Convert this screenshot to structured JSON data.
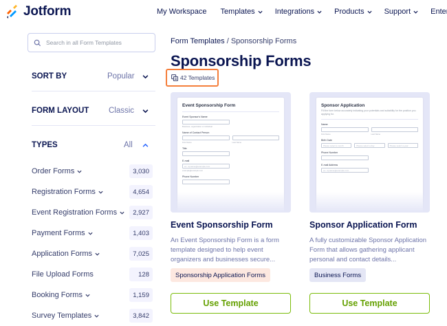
{
  "brand": {
    "name": "Jotform"
  },
  "nav": {
    "items": [
      {
        "label": "My Workspace",
        "dropdown": false
      },
      {
        "label": "Templates",
        "dropdown": true
      },
      {
        "label": "Integrations",
        "dropdown": true
      },
      {
        "label": "Products",
        "dropdown": true
      },
      {
        "label": "Support",
        "dropdown": true
      },
      {
        "label": "Enterprise",
        "dropdown": false
      }
    ]
  },
  "sidebar": {
    "search_placeholder": "Search in all Form Templates",
    "sort": {
      "title": "SORT BY",
      "value": "Popular"
    },
    "layout": {
      "title": "FORM LAYOUT",
      "value": "Classic"
    },
    "types": {
      "title": "TYPES",
      "value": "All"
    },
    "categories": [
      {
        "label": "Order Forms",
        "count": "3,030",
        "dropdown": true
      },
      {
        "label": "Registration Forms",
        "count": "4,654",
        "dropdown": true
      },
      {
        "label": "Event Registration Forms",
        "count": "2,927",
        "dropdown": true
      },
      {
        "label": "Payment Forms",
        "count": "1,403",
        "dropdown": true
      },
      {
        "label": "Application Forms",
        "count": "7,025",
        "dropdown": true
      },
      {
        "label": "File Upload Forms",
        "count": "128",
        "dropdown": false
      },
      {
        "label": "Booking Forms",
        "count": "1,159",
        "dropdown": true
      },
      {
        "label": "Survey Templates",
        "count": "3,842",
        "dropdown": true
      }
    ]
  },
  "main": {
    "breadcrumb": {
      "parent": "Form Templates",
      "separator": " / ",
      "current": "Sponsorship Forms"
    },
    "title": "Sponsorship Forms",
    "template_count": "42 Templates",
    "cards": [
      {
        "title": "Event Sponsorship Form",
        "description": "An Event Sponsorship Form is a form template designed to help event organizers and businesses secure...",
        "tag": "Sponsorship Application Forms",
        "tag_bg": "#fde8e0",
        "tag_color": "#0a1551",
        "button": "Use Template",
        "preview": {
          "title": "Event Sponsorship Form",
          "fields": {
            "sponsor_name": "Event Sponsor's Name",
            "sponsor_sub": "Business, organization or individual",
            "contact_name": "Name of Contact Person",
            "first": "First Name",
            "last": "Last Name",
            "title_label": "Title",
            "email": "E-mail",
            "email_ph": "ex: myname@example.com",
            "email_sub": "example@example.com",
            "phone": "Phone Number"
          }
        }
      },
      {
        "title": "Sponsor Application Form",
        "description": "A fully customizable Sponsor Application Form that allows gathering applicant personal and contact details...",
        "tag": "Business Forms",
        "tag_bg": "#e4e6f5",
        "tag_color": "#0a1551",
        "button": "Use Template",
        "preview": {
          "title": "Sponsor Application",
          "description": "Fill the form below accurately indicating your potentials and suitability for the position you applying for.",
          "fields": {
            "name": "Name",
            "first": "First Name",
            "last": "Last Name",
            "birth": "Birth Date",
            "month": "Please select a month",
            "day": "Please select a day",
            "year": "Please select a year",
            "phone": "Phone Number",
            "email": "E-mail Address",
            "email_ph": "ex: myname@example.com"
          }
        }
      }
    ]
  },
  "colors": {
    "accent": "#0a1551",
    "button_green": "#64a000",
    "highlight": "#f57e3a"
  }
}
